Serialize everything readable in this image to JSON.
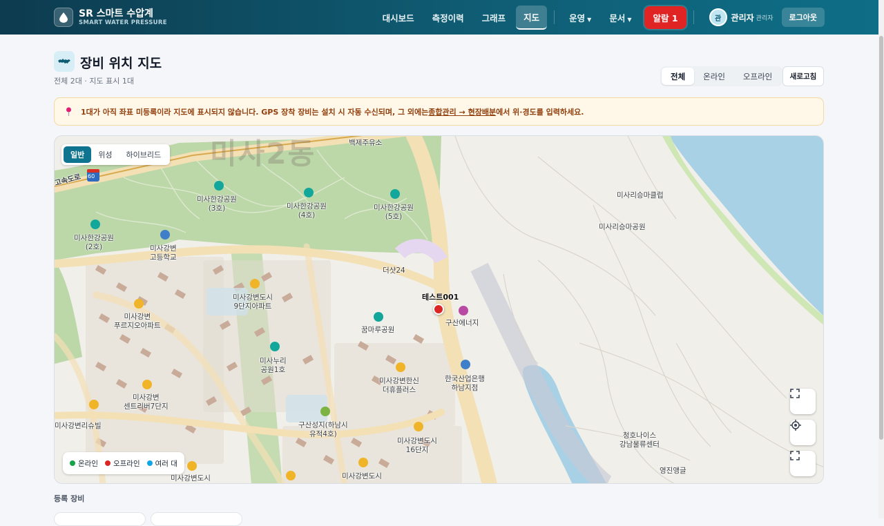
{
  "brand": {
    "name": "SR 스마트 수압계",
    "sub": "SMART WATER PRESSURE"
  },
  "nav": {
    "items": [
      {
        "label": "대시보드"
      },
      {
        "label": "측정이력"
      },
      {
        "label": "그래프"
      },
      {
        "label": "지도"
      }
    ],
    "ops": "운영",
    "docs": "문서",
    "alarm": "알람 1",
    "avatar": "관",
    "user": "관리자",
    "role": "관리자",
    "logout": "로그아웃"
  },
  "page": {
    "title": "장비 위치 지도",
    "sub": "전체 2대 · 지도 표시 1대",
    "filters": [
      "전체",
      "온라인",
      "오프라인"
    ],
    "refresh": "새로고침"
  },
  "notice": {
    "before": "1대가 아직 좌표 미등록이라 지도에 표시되지 않습니다. GPS 장착 장비는 설치 시 자동 수신되며, 그 외에는 ",
    "link": "종합관리 → 현장배분",
    "after": "에서 위·경도를 입력하세요."
  },
  "map": {
    "types": [
      "일반",
      "위성",
      "하이브리드"
    ],
    "dong": "미사2동",
    "marker": {
      "name": "테스트001",
      "status": "오프라인"
    },
    "legend": {
      "online": "온라인",
      "offline": "오프라인",
      "multi": "여러 대"
    },
    "colors": {
      "online": "#16a34a",
      "offline": "#dc2626",
      "multi": "#0ea5e9"
    },
    "labels": {
      "gas": "백제주유소",
      "park3": "미사한강공원\n(3호)",
      "park4": "미사한강공원\n(4호)",
      "park5": "미사한강공원\n(5호)",
      "park2": "미사한강공원\n(2호)",
      "school": "미사강변\n고등학교",
      "the24": "더샷24",
      "apt9": "미사강변도시\n9단지아파트",
      "purgio": "미사강변\n푸르지오아파트",
      "kkum": "꿈마루공원",
      "energy": "구산에너지",
      "nuri": "미사누리\n공원1호",
      "hansin": "미사강변한신\n더휴플러스",
      "bank": "한국산업은행\n하남지점",
      "central7": "미사강변\n센트리버7단지",
      "risu": "미사강변리슈빌",
      "gusan": "구산성지(하남시\n유적4호)",
      "apt16": "미사강변도시\n16단지",
      "apt_b1": "미사강변도시",
      "apt_b2": "미사강변도시",
      "rowing": "미사리승마클럽",
      "horse": "미사리승마공원",
      "chungho": "청호나이스\n강남물류센터",
      "youngjin": "영진앵글",
      "highway": "고속도로",
      "route": "60"
    }
  },
  "devices": {
    "title": "등록 장비"
  }
}
